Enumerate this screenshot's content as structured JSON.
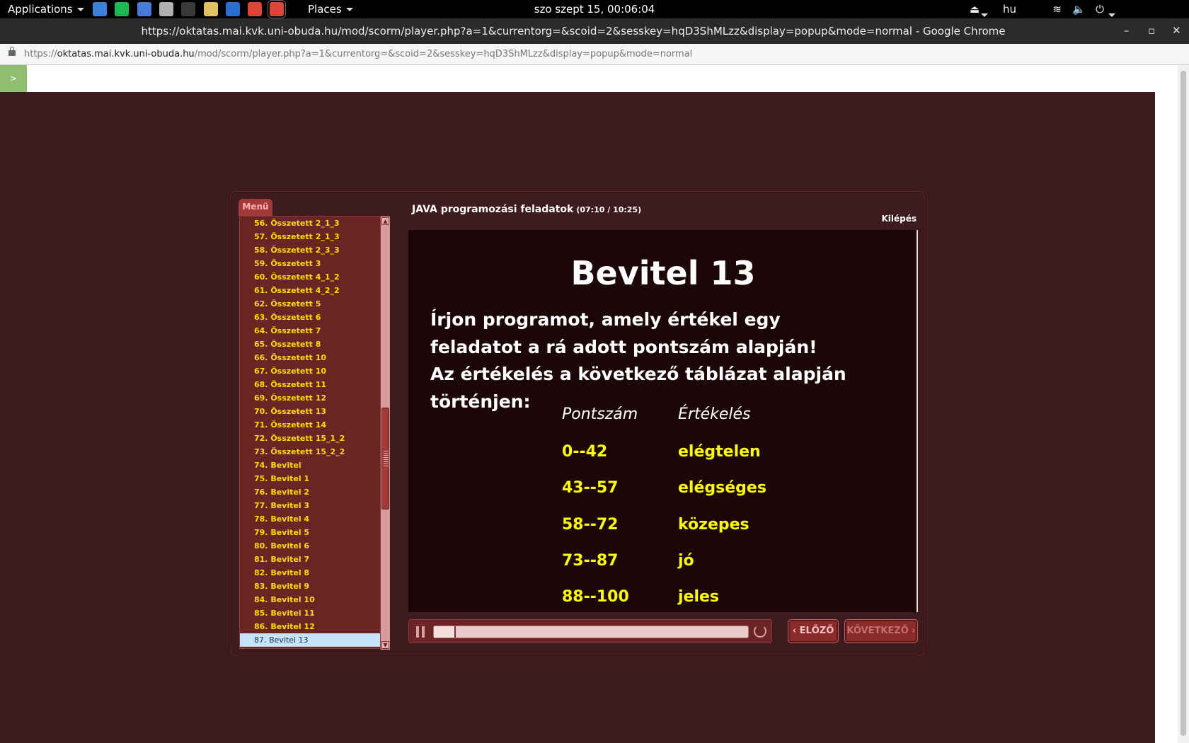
{
  "topbar": {
    "applications": "Applications",
    "places": "Places",
    "clock": "szo szept 15, 00:06:04",
    "language": "hu",
    "launchers": [
      {
        "icon": "display-icon",
        "color": "#3b7fd9"
      },
      {
        "icon": "spotify-icon",
        "color": "#1db954"
      },
      {
        "icon": "chromium-icon",
        "color": "#4b7bd8"
      },
      {
        "icon": "screenshot-tool-icon",
        "color": "#b0b0b0"
      },
      {
        "icon": "terminal-icon",
        "color": "#3a3a3a"
      },
      {
        "icon": "text-editor-icon",
        "color": "#e0c060"
      },
      {
        "icon": "system-monitor-icon",
        "color": "#2a6fd0"
      },
      {
        "icon": "chrome-icon",
        "color": "#db4437"
      },
      {
        "icon": "chrome-active-icon",
        "color": "#db4437"
      }
    ]
  },
  "window": {
    "title": "https://oktatas.mai.kvk.uni-obuda.hu/mod/scorm/player.php?a=1&currentorg=&scoid=2&sesskey=hqD3ShMLzz&display=popup&mode=normal - Google Chrome"
  },
  "address": {
    "scheme": "https://",
    "domain": "oktatas.mai.kvk.uni-obuda.hu",
    "path": "/mod/scorm/player.php?a=1&currentorg=&scoid=2&sesskey=hqD3ShMLzz&display=popup&mode=normal"
  },
  "page": {
    "toggle_label": ">"
  },
  "player": {
    "menu_tab": "Menü",
    "title": "JAVA programozási feladatok",
    "time": "(07:10 / 10:25)",
    "exit": "Kilépés",
    "prev": "‹ ELŐZŐ",
    "next": "KÖVETKEZŐ ›",
    "progress_fraction": 0.07,
    "menu_items": [
      "56. Összetett 2_1_3",
      "57. Összetett 2_1_3",
      "58. Összetett 2_3_3",
      "59. Összetett 3",
      "60. Összetett 4_1_2",
      "61. Összetett 4_2_2",
      "62. Összetett 5",
      "63. Összetett 6",
      "64. Összetett 7",
      "65. Összetett 8",
      "66. Összetett 10",
      "67. Összetett 10",
      "68. Összetett 11",
      "69. Összetett 12",
      "70. Összetett 13",
      "71. Összetett 14",
      "72. Összetett 15_1_2",
      "73. Összetett 15_2_2",
      "74. Bevitel",
      "75. Bevitel 1",
      "76. Bevitel 2",
      "77. Bevitel 3",
      "78. Bevitel 4",
      "79. Bevitel 5",
      "80. Bevitel 6",
      "81. Bevitel 7",
      "82. Bevitel 8",
      "83. Bevitel 9",
      "84. Bevitel 10",
      "85. Bevitel 11",
      "86. Bevitel 12",
      "87. Bevitel 13"
    ],
    "selected_index": 31
  },
  "slide": {
    "heading": "Bevitel 13",
    "body_lines": [
      "Írjon programot, amely értékel egy",
      "feladatot a rá adott pontszám alapján!",
      "Az értékelés a következő táblázat alapján",
      "történjen:"
    ],
    "table": {
      "headers": [
        "Pontszám",
        "Értékelés"
      ],
      "rows": [
        [
          "0--42",
          "elégtelen"
        ],
        [
          "43--57",
          "elégséges"
        ],
        [
          "58--72",
          "közepes"
        ],
        [
          "73--87",
          "jó"
        ],
        [
          "88--100",
          "jeles"
        ]
      ]
    }
  }
}
